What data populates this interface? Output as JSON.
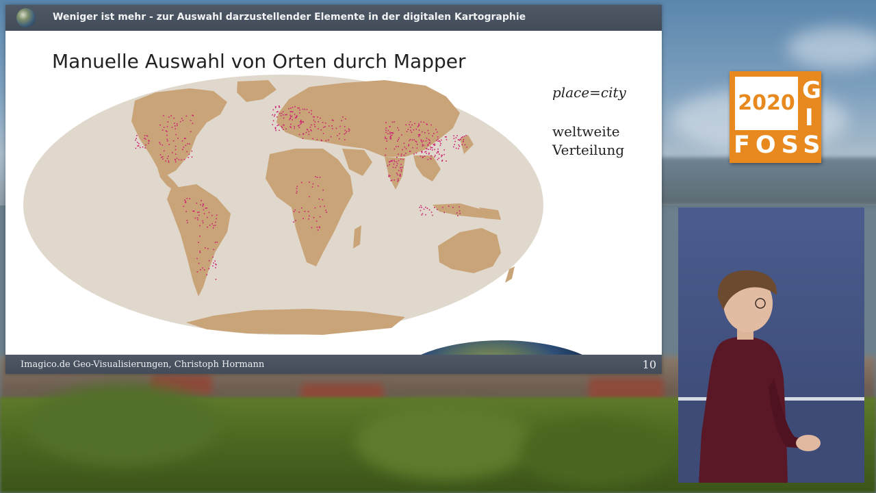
{
  "slide": {
    "header_title": "Weniger ist mehr - zur Auswahl darzustellender Elemente in der digitalen Kartographie",
    "title": "Manuelle Auswahl von Orten durch Mapper",
    "note_tag": "place=city",
    "note_desc": "weltweite Verteilung",
    "footer_credit": "Imagico.de Geo-Visualisierungen, Christoph Hormann",
    "page_number": "10"
  },
  "map": {
    "ocean_color": "#e0d8cc",
    "land_color": "#c9a478",
    "marker_color": "#cc1f72",
    "icon": "world-map-icon"
  },
  "logo": {
    "year": "2020",
    "letter_g": "G",
    "letter_i": "I",
    "word": "FOSS",
    "color": "#e7891e"
  },
  "speaker_video": {
    "icon": "speaker-video-icon"
  }
}
